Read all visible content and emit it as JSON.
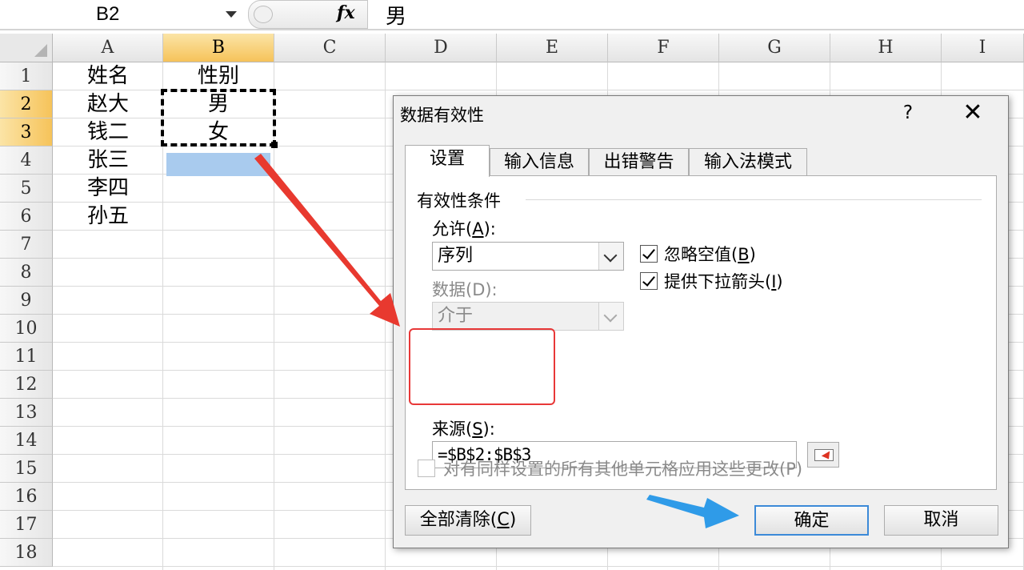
{
  "formula_bar": {
    "name_box": "B2",
    "fx_label": "fx",
    "formula_value": "男"
  },
  "grid": {
    "columns": [
      "A",
      "B",
      "C",
      "D",
      "E",
      "F",
      "G",
      "H",
      "I"
    ],
    "selected_column": "B",
    "rows": [
      "1",
      "2",
      "3",
      "4",
      "5",
      "6",
      "7",
      "8",
      "9",
      "10",
      "11",
      "12",
      "13",
      "14",
      "15",
      "16",
      "17",
      "18"
    ],
    "selected_rows": [
      "2",
      "3"
    ],
    "cells": {
      "A1": "姓名",
      "B1": "性别",
      "A2": "赵大",
      "B2": "男",
      "A3": "钱二",
      "B3": "女",
      "A4": "张三",
      "A5": "李四",
      "A6": "孙五"
    }
  },
  "dialog": {
    "title": "数据有效性",
    "help": "?",
    "close": "✕",
    "tabs": [
      "设置",
      "输入信息",
      "出错警告",
      "输入法模式"
    ],
    "active_tab": "设置",
    "group_label": "有效性条件",
    "allow_label_pre": "允许(",
    "allow_key": "A",
    "allow_label_post": "):",
    "allow_value": "序列",
    "ignore_blank_pre": "忽略空值(",
    "ignore_blank_key": "B",
    "ignore_blank_post": ")",
    "ignore_blank_checked": true,
    "dropdown_pre": "提供下拉箭头(",
    "dropdown_key": "I",
    "dropdown_post": ")",
    "dropdown_checked": true,
    "data_label": "数据(D):",
    "data_value": "介于",
    "source_label_pre": "来源(",
    "source_key": "S",
    "source_label_post": "):",
    "source_value": "=$B$2:$B$3",
    "apply_all_label": "对有同样设置的所有其他单元格应用这些更改(P)",
    "apply_all_checked": false,
    "clear_all_pre": "全部清除(",
    "clear_all_key": "C",
    "clear_all_post": ")",
    "ok": "确定",
    "cancel": "取消"
  },
  "annotations": {
    "arrow_red_color": "#e8392f",
    "arrow_blue_color": "#2f9be8",
    "highlight_box_color": "#e83838"
  }
}
